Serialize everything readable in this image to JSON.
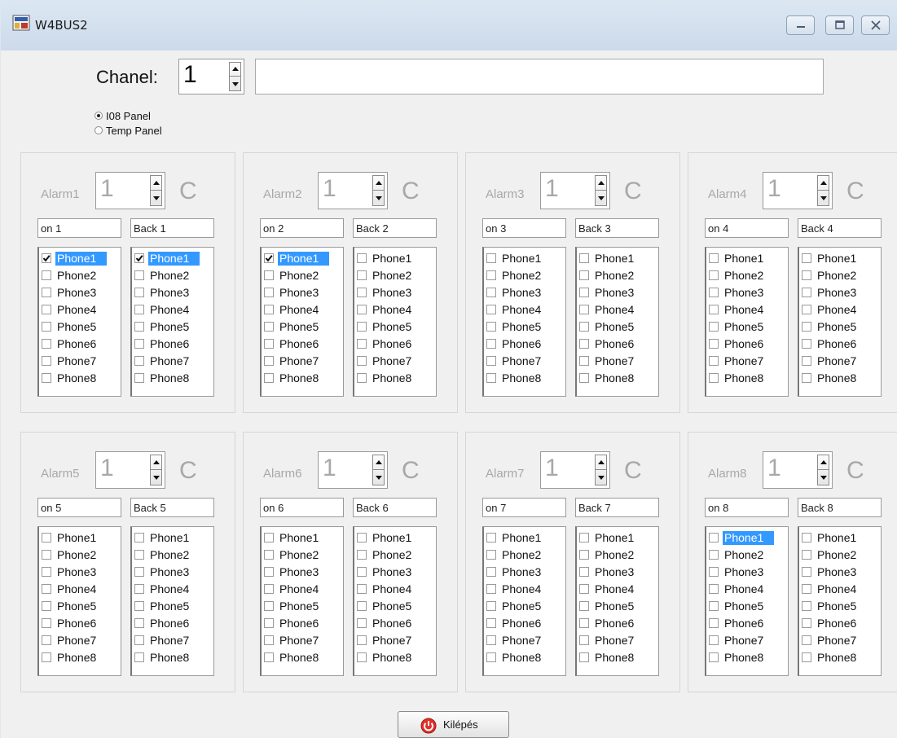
{
  "window": {
    "title": "W4BUS2"
  },
  "channel": {
    "label": "Chanel:",
    "value": "1",
    "description": ""
  },
  "panel_type": {
    "options": [
      "I08 Panel",
      "Temp Panel"
    ],
    "selected": "I08 Panel"
  },
  "alarms": [
    {
      "label": "Alarm1",
      "value": "1",
      "unit": "C",
      "on_text": "on 1",
      "back_text": "Back 1",
      "on_list": [
        {
          "label": "Phone1",
          "checked": true,
          "selected": true
        },
        {
          "label": "Phone2",
          "checked": false
        },
        {
          "label": "Phone3",
          "checked": false
        },
        {
          "label": "Phone4",
          "checked": false
        },
        {
          "label": "Phone5",
          "checked": false
        },
        {
          "label": "Phone6",
          "checked": false
        },
        {
          "label": "Phone7",
          "checked": false
        },
        {
          "label": "Phone8",
          "checked": false
        }
      ],
      "back_list": [
        {
          "label": "Phone1",
          "checked": true,
          "selected": true
        },
        {
          "label": "Phone2",
          "checked": false
        },
        {
          "label": "Phone3",
          "checked": false
        },
        {
          "label": "Phone4",
          "checked": false
        },
        {
          "label": "Phone5",
          "checked": false
        },
        {
          "label": "Phone6",
          "checked": false
        },
        {
          "label": "Phone7",
          "checked": false
        },
        {
          "label": "Phone8",
          "checked": false
        }
      ]
    },
    {
      "label": "Alarm2",
      "value": "1",
      "unit": "C",
      "on_text": "on 2",
      "back_text": "Back 2",
      "on_list": [
        {
          "label": "Phone1",
          "checked": true,
          "selected": true
        },
        {
          "label": "Phone2",
          "checked": false
        },
        {
          "label": "Phone3",
          "checked": false
        },
        {
          "label": "Phone4",
          "checked": false
        },
        {
          "label": "Phone5",
          "checked": false
        },
        {
          "label": "Phone6",
          "checked": false
        },
        {
          "label": "Phone7",
          "checked": false
        },
        {
          "label": "Phone8",
          "checked": false
        }
      ],
      "back_list": [
        {
          "label": "Phone1",
          "checked": false
        },
        {
          "label": "Phone2",
          "checked": false
        },
        {
          "label": "Phone3",
          "checked": false
        },
        {
          "label": "Phone4",
          "checked": false
        },
        {
          "label": "Phone5",
          "checked": false
        },
        {
          "label": "Phone6",
          "checked": false
        },
        {
          "label": "Phone7",
          "checked": false
        },
        {
          "label": "Phone8",
          "checked": false
        }
      ]
    },
    {
      "label": "Alarm3",
      "value": "1",
      "unit": "C",
      "on_text": "on 3",
      "back_text": "Back 3",
      "on_list": [
        {
          "label": "Phone1",
          "checked": false
        },
        {
          "label": "Phone2",
          "checked": false
        },
        {
          "label": "Phone3",
          "checked": false
        },
        {
          "label": "Phone4",
          "checked": false
        },
        {
          "label": "Phone5",
          "checked": false
        },
        {
          "label": "Phone6",
          "checked": false
        },
        {
          "label": "Phone7",
          "checked": false
        },
        {
          "label": "Phone8",
          "checked": false
        }
      ],
      "back_list": [
        {
          "label": "Phone1",
          "checked": false
        },
        {
          "label": "Phone2",
          "checked": false
        },
        {
          "label": "Phone3",
          "checked": false
        },
        {
          "label": "Phone4",
          "checked": false
        },
        {
          "label": "Phone5",
          "checked": false
        },
        {
          "label": "Phone6",
          "checked": false
        },
        {
          "label": "Phone7",
          "checked": false
        },
        {
          "label": "Phone8",
          "checked": false
        }
      ]
    },
    {
      "label": "Alarm4",
      "value": "1",
      "unit": "C",
      "on_text": "on 4",
      "back_text": "Back 4",
      "on_list": [
        {
          "label": "Phone1",
          "checked": false
        },
        {
          "label": "Phone2",
          "checked": false
        },
        {
          "label": "Phone3",
          "checked": false
        },
        {
          "label": "Phone4",
          "checked": false
        },
        {
          "label": "Phone5",
          "checked": false
        },
        {
          "label": "Phone6",
          "checked": false
        },
        {
          "label": "Phone7",
          "checked": false
        },
        {
          "label": "Phone8",
          "checked": false
        }
      ],
      "back_list": [
        {
          "label": "Phone1",
          "checked": false
        },
        {
          "label": "Phone2",
          "checked": false
        },
        {
          "label": "Phone3",
          "checked": false
        },
        {
          "label": "Phone4",
          "checked": false
        },
        {
          "label": "Phone5",
          "checked": false
        },
        {
          "label": "Phone6",
          "checked": false
        },
        {
          "label": "Phone7",
          "checked": false
        },
        {
          "label": "Phone8",
          "checked": false
        }
      ]
    },
    {
      "label": "Alarm5",
      "value": "1",
      "unit": "C",
      "on_text": "on 5",
      "back_text": "Back 5",
      "on_list": [
        {
          "label": "Phone1",
          "checked": false
        },
        {
          "label": "Phone2",
          "checked": false
        },
        {
          "label": "Phone3",
          "checked": false
        },
        {
          "label": "Phone4",
          "checked": false
        },
        {
          "label": "Phone5",
          "checked": false
        },
        {
          "label": "Phone6",
          "checked": false
        },
        {
          "label": "Phone7",
          "checked": false
        },
        {
          "label": "Phone8",
          "checked": false
        }
      ],
      "back_list": [
        {
          "label": "Phone1",
          "checked": false
        },
        {
          "label": "Phone2",
          "checked": false
        },
        {
          "label": "Phone3",
          "checked": false
        },
        {
          "label": "Phone4",
          "checked": false
        },
        {
          "label": "Phone5",
          "checked": false
        },
        {
          "label": "Phone6",
          "checked": false
        },
        {
          "label": "Phone7",
          "checked": false
        },
        {
          "label": "Phone8",
          "checked": false
        }
      ]
    },
    {
      "label": "Alarm6",
      "value": "1",
      "unit": "C",
      "on_text": "on 6",
      "back_text": "Back 6",
      "on_list": [
        {
          "label": "Phone1",
          "checked": false
        },
        {
          "label": "Phone2",
          "checked": false
        },
        {
          "label": "Phone3",
          "checked": false
        },
        {
          "label": "Phone4",
          "checked": false
        },
        {
          "label": "Phone5",
          "checked": false
        },
        {
          "label": "Phone6",
          "checked": false
        },
        {
          "label": "Phone7",
          "checked": false
        },
        {
          "label": "Phone8",
          "checked": false
        }
      ],
      "back_list": [
        {
          "label": "Phone1",
          "checked": false
        },
        {
          "label": "Phone2",
          "checked": false
        },
        {
          "label": "Phone3",
          "checked": false
        },
        {
          "label": "Phone4",
          "checked": false
        },
        {
          "label": "Phone5",
          "checked": false
        },
        {
          "label": "Phone6",
          "checked": false
        },
        {
          "label": "Phone7",
          "checked": false
        },
        {
          "label": "Phone8",
          "checked": false
        }
      ]
    },
    {
      "label": "Alarm7",
      "value": "1",
      "unit": "C",
      "on_text": "on 7",
      "back_text": "Back 7",
      "on_list": [
        {
          "label": "Phone1",
          "checked": false
        },
        {
          "label": "Phone2",
          "checked": false
        },
        {
          "label": "Phone3",
          "checked": false
        },
        {
          "label": "Phone4",
          "checked": false
        },
        {
          "label": "Phone5",
          "checked": false
        },
        {
          "label": "Phone6",
          "checked": false
        },
        {
          "label": "Phone7",
          "checked": false
        },
        {
          "label": "Phone8",
          "checked": false
        }
      ],
      "back_list": [
        {
          "label": "Phone1",
          "checked": false
        },
        {
          "label": "Phone2",
          "checked": false
        },
        {
          "label": "Phone3",
          "checked": false
        },
        {
          "label": "Phone4",
          "checked": false
        },
        {
          "label": "Phone5",
          "checked": false
        },
        {
          "label": "Phone6",
          "checked": false
        },
        {
          "label": "Phone7",
          "checked": false
        },
        {
          "label": "Phone8",
          "checked": false
        }
      ]
    },
    {
      "label": "Alarm8",
      "value": "1",
      "unit": "C",
      "on_text": "on 8",
      "back_text": "Back 8",
      "on_list": [
        {
          "label": "Phone1",
          "checked": false,
          "selected": true
        },
        {
          "label": "Phone2",
          "checked": false
        },
        {
          "label": "Phone3",
          "checked": false
        },
        {
          "label": "Phone4",
          "checked": false
        },
        {
          "label": "Phone5",
          "checked": false
        },
        {
          "label": "Phone6",
          "checked": false
        },
        {
          "label": "Phone7",
          "checked": false
        },
        {
          "label": "Phone8",
          "checked": false
        }
      ],
      "back_list": [
        {
          "label": "Phone1",
          "checked": false
        },
        {
          "label": "Phone2",
          "checked": false
        },
        {
          "label": "Phone3",
          "checked": false
        },
        {
          "label": "Phone4",
          "checked": false
        },
        {
          "label": "Phone5",
          "checked": false
        },
        {
          "label": "Phone6",
          "checked": false
        },
        {
          "label": "Phone7",
          "checked": false
        },
        {
          "label": "Phone8",
          "checked": false
        }
      ]
    }
  ],
  "exit_button": {
    "label": "Kilépés",
    "icon": "power-icon"
  },
  "colors": {
    "selection": "#3399ff",
    "disabled_text": "#a8a8a8",
    "exit_icon": "#e0302a"
  }
}
